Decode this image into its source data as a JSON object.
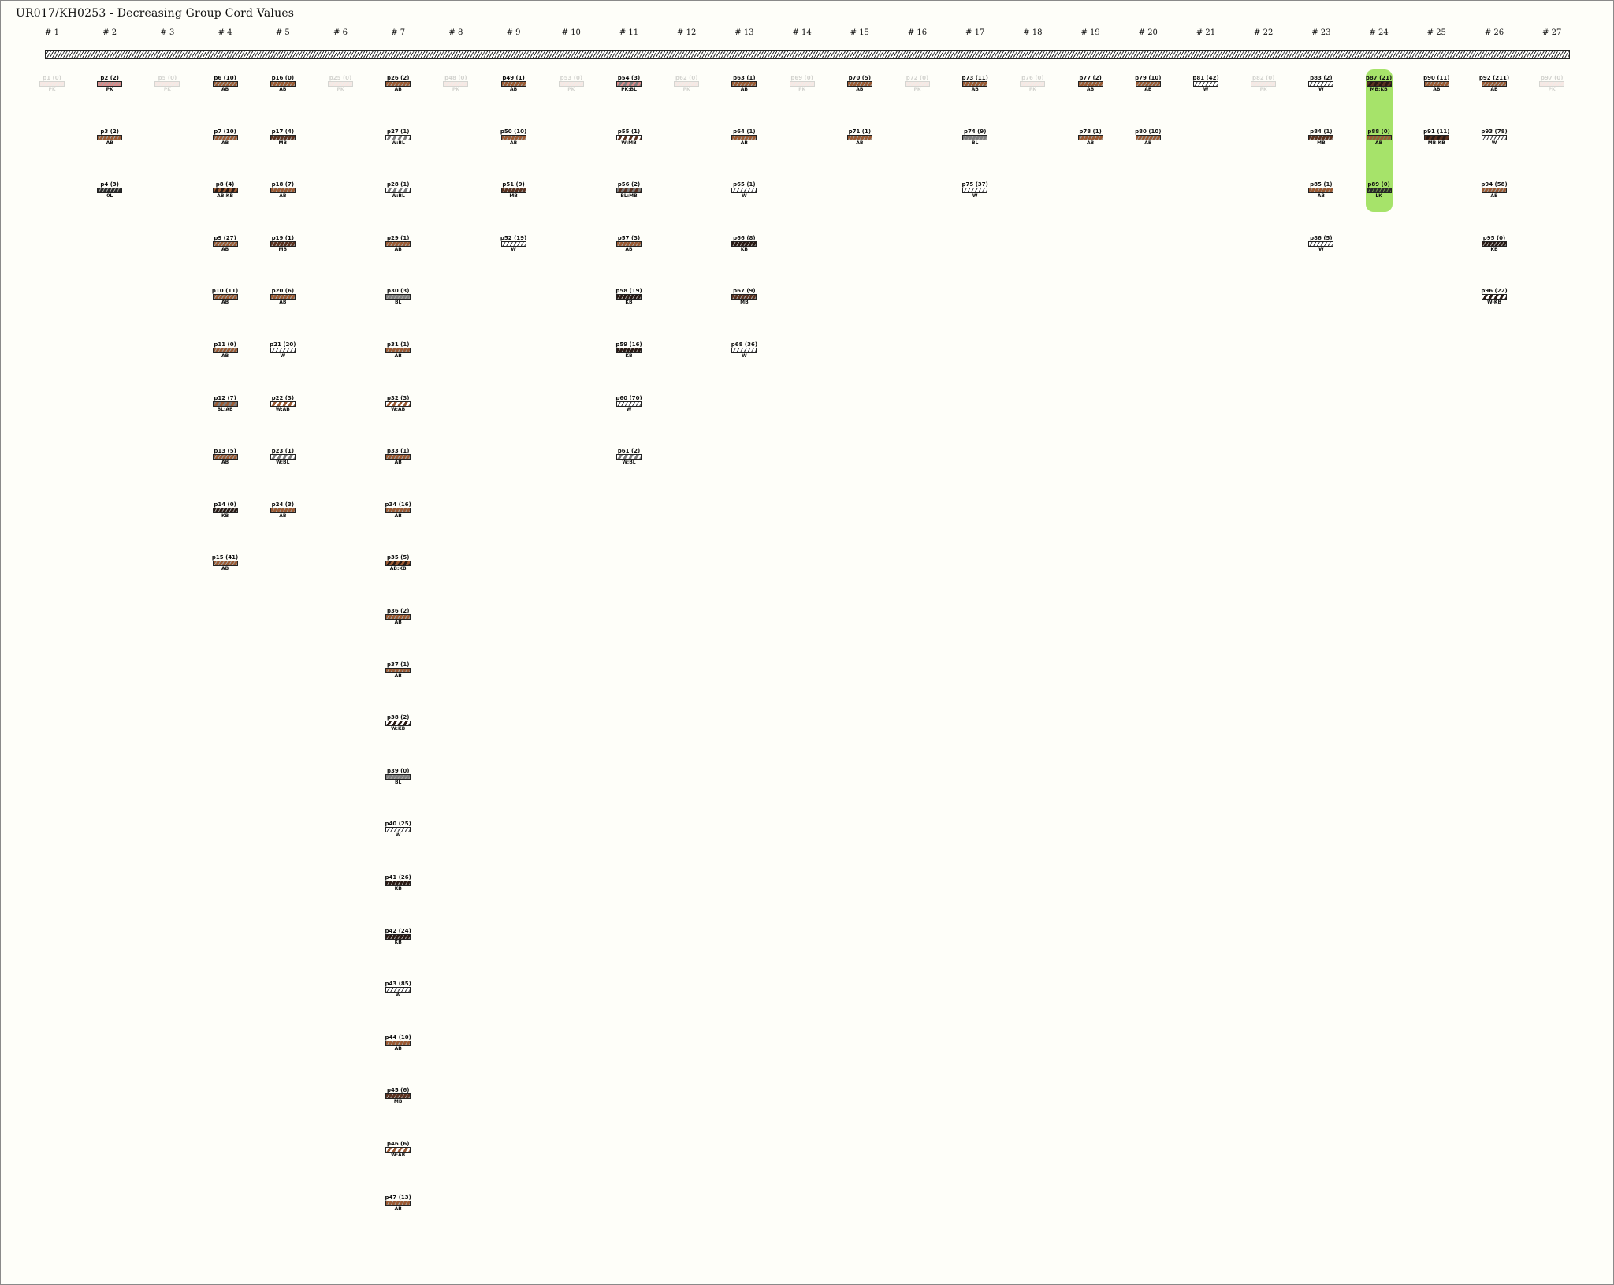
{
  "title": "UR017/KH0253 - Decreasing Group Cord Values",
  "groups": [
    "# 1",
    "# 2",
    "# 3",
    "# 4",
    "# 5",
    "# 6",
    "# 7",
    "# 8",
    "# 9",
    "# 10",
    "# 11",
    "# 12",
    "# 13",
    "# 14",
    "# 15",
    "# 16",
    "# 17",
    "# 18",
    "# 19",
    "# 20",
    "# 21",
    "# 22",
    "# 23",
    "# 24",
    "# 25",
    "# 26",
    "# 27"
  ],
  "highlight_group": 24,
  "colors": {
    "AB": "#9b5a33",
    "MB": "#5b3220",
    "KB": "#2a1a14",
    "0L": "#2b2b2b",
    "BL": "#7d7d7d",
    "W": "#ffffff",
    "PK": "#d98b8b",
    "LK": "#2b2b2b",
    "highlight": "#a6e36a"
  },
  "cords": [
    {
      "group": 1,
      "row": 0,
      "label": "p1 (0)",
      "color": "PK",
      "faded": true
    },
    {
      "group": 2,
      "row": 0,
      "label": "p2 (2)",
      "color": "PK"
    },
    {
      "group": 2,
      "row": 1,
      "label": "p3 (2)",
      "color": "AB"
    },
    {
      "group": 2,
      "row": 2,
      "label": "p4 (3)",
      "color": "0L"
    },
    {
      "group": 3,
      "row": 0,
      "label": "p5 (0)",
      "color": "PK",
      "faded": true
    },
    {
      "group": 4,
      "row": 0,
      "label": "p6 (10)",
      "color": "AB"
    },
    {
      "group": 4,
      "row": 1,
      "label": "p7 (10)",
      "color": "AB"
    },
    {
      "group": 4,
      "row": 2,
      "label": "p8 (4)",
      "color": "AB:KB"
    },
    {
      "group": 4,
      "row": 3,
      "label": "p9 (27)",
      "color": "AB"
    },
    {
      "group": 4,
      "row": 4,
      "label": "p10 (11)",
      "color": "AB"
    },
    {
      "group": 4,
      "row": 5,
      "label": "p11 (0)",
      "color": "AB"
    },
    {
      "group": 4,
      "row": 6,
      "label": "p12 (7)",
      "color": "BL:AB"
    },
    {
      "group": 4,
      "row": 7,
      "label": "p13 (5)",
      "color": "AB"
    },
    {
      "group": 4,
      "row": 8,
      "label": "p14 (0)",
      "color": "KB"
    },
    {
      "group": 4,
      "row": 9,
      "label": "p15 (41)",
      "color": "AB"
    },
    {
      "group": 5,
      "row": 0,
      "label": "p16 (0)",
      "color": "AB"
    },
    {
      "group": 5,
      "row": 1,
      "label": "p17 (4)",
      "color": "MB"
    },
    {
      "group": 5,
      "row": 2,
      "label": "p18 (7)",
      "color": "AB"
    },
    {
      "group": 5,
      "row": 3,
      "label": "p19 (1)",
      "color": "MB"
    },
    {
      "group": 5,
      "row": 4,
      "label": "p20 (6)",
      "color": "AB"
    },
    {
      "group": 5,
      "row": 5,
      "label": "p21 (20)",
      "color": "W"
    },
    {
      "group": 5,
      "row": 6,
      "label": "p22 (3)",
      "color": "W:AB"
    },
    {
      "group": 5,
      "row": 7,
      "label": "p23 (1)",
      "color": "W:BL"
    },
    {
      "group": 5,
      "row": 8,
      "label": "p24 (3)",
      "color": "AB"
    },
    {
      "group": 6,
      "row": 0,
      "label": "p25 (0)",
      "color": "PK",
      "faded": true
    },
    {
      "group": 7,
      "row": 0,
      "label": "p26 (2)",
      "color": "AB"
    },
    {
      "group": 7,
      "row": 1,
      "label": "p27 (1)",
      "color": "W:BL"
    },
    {
      "group": 7,
      "row": 2,
      "label": "p28 (1)",
      "color": "W:BL"
    },
    {
      "group": 7,
      "row": 3,
      "label": "p29 (1)",
      "color": "AB"
    },
    {
      "group": 7,
      "row": 4,
      "label": "p30 (3)",
      "color": "BL"
    },
    {
      "group": 7,
      "row": 5,
      "label": "p31 (1)",
      "color": "AB"
    },
    {
      "group": 7,
      "row": 6,
      "label": "p32 (3)",
      "color": "W:AB"
    },
    {
      "group": 7,
      "row": 7,
      "label": "p33 (1)",
      "color": "AB"
    },
    {
      "group": 7,
      "row": 8,
      "label": "p34 (16)",
      "color": "AB"
    },
    {
      "group": 7,
      "row": 9,
      "label": "p35 (5)",
      "color": "AB:KB"
    },
    {
      "group": 7,
      "row": 10,
      "label": "p36 (2)",
      "color": "AB"
    },
    {
      "group": 7,
      "row": 11,
      "label": "p37 (1)",
      "color": "AB"
    },
    {
      "group": 7,
      "row": 12,
      "label": "p38 (2)",
      "color": "W:KB"
    },
    {
      "group": 7,
      "row": 13,
      "label": "p39 (0)",
      "color": "BL"
    },
    {
      "group": 7,
      "row": 14,
      "label": "p40 (25)",
      "color": "W"
    },
    {
      "group": 7,
      "row": 15,
      "label": "p41 (26)",
      "color": "KB"
    },
    {
      "group": 7,
      "row": 16,
      "label": "p42 (24)",
      "color": "KB"
    },
    {
      "group": 7,
      "row": 17,
      "label": "p43 (85)",
      "color": "W"
    },
    {
      "group": 7,
      "row": 18,
      "label": "p44 (10)",
      "color": "AB"
    },
    {
      "group": 7,
      "row": 19,
      "label": "p45 (6)",
      "color": "MB"
    },
    {
      "group": 7,
      "row": 20,
      "label": "p46 (6)",
      "color": "W:AB"
    },
    {
      "group": 7,
      "row": 21,
      "label": "p47 (13)",
      "color": "AB"
    },
    {
      "group": 8,
      "row": 0,
      "label": "p48 (0)",
      "color": "PK",
      "faded": true
    },
    {
      "group": 9,
      "row": 0,
      "label": "p49 (1)",
      "color": "AB"
    },
    {
      "group": 9,
      "row": 1,
      "label": "p50 (10)",
      "color": "AB"
    },
    {
      "group": 9,
      "row": 2,
      "label": "p51 (9)",
      "color": "MB"
    },
    {
      "group": 9,
      "row": 3,
      "label": "p52 (19)",
      "color": "W"
    },
    {
      "group": 10,
      "row": 0,
      "label": "p53 (0)",
      "color": "PK",
      "faded": true
    },
    {
      "group": 11,
      "row": 0,
      "label": "p54 (3)",
      "color": "PK:BL"
    },
    {
      "group": 11,
      "row": 1,
      "label": "p55 (1)",
      "color": "W:MB"
    },
    {
      "group": 11,
      "row": 2,
      "label": "p56 (2)",
      "color": "BL:MB"
    },
    {
      "group": 11,
      "row": 3,
      "label": "p57 (3)",
      "color": "AB"
    },
    {
      "group": 11,
      "row": 4,
      "label": "p58 (19)",
      "color": "KB"
    },
    {
      "group": 11,
      "row": 5,
      "label": "p59 (16)",
      "color": "KB"
    },
    {
      "group": 11,
      "row": 6,
      "label": "p60 (70)",
      "color": "W"
    },
    {
      "group": 11,
      "row": 7,
      "label": "p61 (2)",
      "color": "W:BL"
    },
    {
      "group": 12,
      "row": 0,
      "label": "p62 (0)",
      "color": "PK",
      "faded": true
    },
    {
      "group": 13,
      "row": 0,
      "label": "p63 (1)",
      "color": "AB"
    },
    {
      "group": 13,
      "row": 1,
      "label": "p64 (1)",
      "color": "AB"
    },
    {
      "group": 13,
      "row": 2,
      "label": "p65 (1)",
      "color": "W"
    },
    {
      "group": 13,
      "row": 3,
      "label": "p66 (8)",
      "color": "KB"
    },
    {
      "group": 13,
      "row": 4,
      "label": "p67 (9)",
      "color": "MB"
    },
    {
      "group": 13,
      "row": 5,
      "label": "p68 (36)",
      "color": "W"
    },
    {
      "group": 14,
      "row": 0,
      "label": "p69 (0)",
      "color": "PK",
      "faded": true
    },
    {
      "group": 15,
      "row": 0,
      "label": "p70 (5)",
      "color": "AB"
    },
    {
      "group": 15,
      "row": 1,
      "label": "p71 (1)",
      "color": "AB"
    },
    {
      "group": 16,
      "row": 0,
      "label": "p72 (0)",
      "color": "PK",
      "faded": true
    },
    {
      "group": 17,
      "row": 0,
      "label": "p73 (11)",
      "color": "AB"
    },
    {
      "group": 17,
      "row": 1,
      "label": "p74 (9)",
      "color": "BL"
    },
    {
      "group": 17,
      "row": 2,
      "label": "p75 (37)",
      "color": "W"
    },
    {
      "group": 18,
      "row": 0,
      "label": "p76 (0)",
      "color": "PK",
      "faded": true
    },
    {
      "group": 19,
      "row": 0,
      "label": "p77 (2)",
      "color": "AB"
    },
    {
      "group": 19,
      "row": 1,
      "label": "p78 (1)",
      "color": "AB"
    },
    {
      "group": 20,
      "row": 0,
      "label": "p79 (10)",
      "color": "AB"
    },
    {
      "group": 20,
      "row": 1,
      "label": "p80 (10)",
      "color": "AB"
    },
    {
      "group": 21,
      "row": 0,
      "label": "p81 (42)",
      "color": "W"
    },
    {
      "group": 22,
      "row": 0,
      "label": "p82 (0)",
      "color": "PK",
      "faded": true
    },
    {
      "group": 23,
      "row": 0,
      "label": "p83 (2)",
      "color": "W"
    },
    {
      "group": 23,
      "row": 1,
      "label": "p84 (1)",
      "color": "MB"
    },
    {
      "group": 23,
      "row": 2,
      "label": "p85 (1)",
      "color": "AB"
    },
    {
      "group": 23,
      "row": 3,
      "label": "p86 (5)",
      "color": "W"
    },
    {
      "group": 24,
      "row": 0,
      "label": "p87 (21)",
      "color": "MB:KB"
    },
    {
      "group": 24,
      "row": 1,
      "label": "p88 (0)",
      "color": "AB"
    },
    {
      "group": 24,
      "row": 2,
      "label": "p89 (0)",
      "color": "LK"
    },
    {
      "group": 25,
      "row": 0,
      "label": "p90 (11)",
      "color": "AB"
    },
    {
      "group": 25,
      "row": 1,
      "label": "p91 (11)",
      "color": "MB:KB"
    },
    {
      "group": 26,
      "row": 0,
      "label": "p92 (211)",
      "color": "AB"
    },
    {
      "group": 26,
      "row": 1,
      "label": "p93 (78)",
      "color": "W"
    },
    {
      "group": 26,
      "row": 2,
      "label": "p94 (58)",
      "color": "AB"
    },
    {
      "group": 26,
      "row": 3,
      "label": "p95 (0)",
      "color": "KB"
    },
    {
      "group": 26,
      "row": 4,
      "label": "p96 (22)",
      "color": "W-KB"
    },
    {
      "group": 27,
      "row": 0,
      "label": "p97 (0)",
      "color": "PK",
      "faded": true
    }
  ]
}
